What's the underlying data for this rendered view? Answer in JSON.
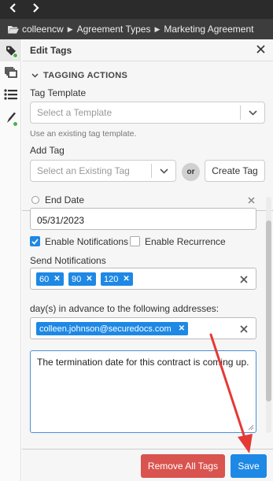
{
  "topbar": {
    "back_icon": "chevron-left-icon",
    "forward_icon": "chevron-right-icon"
  },
  "breadcrumb": {
    "folder_icon": "folder-open-icon",
    "items": [
      "colleencw",
      "Agreement Types",
      "Marketing Agreement"
    ]
  },
  "rail": {
    "items": [
      "tag-icon",
      "stack-icon",
      "list-icon",
      "pen-icon"
    ]
  },
  "panel": {
    "title": "Edit Tags"
  },
  "tagging_actions": {
    "section_title": "TAGGING ACTIONS",
    "tag_template_label": "Tag Template",
    "tag_template_placeholder": "Select a Template",
    "tag_template_help": "Use an existing tag template.",
    "add_tag_label": "Add Tag",
    "add_tag_placeholder": "Select an Existing Tag",
    "or_label": "or",
    "create_tag_label": "Create Tag"
  },
  "end_date": {
    "label": "End Date",
    "value": "05/31/2023"
  },
  "notifications": {
    "enable_notifications_label": "Enable Notifications",
    "enable_notifications_checked": true,
    "enable_recurrence_label": "Enable Recurrence",
    "enable_recurrence_checked": false,
    "send_label": "Send Notifications",
    "days": [
      "60",
      "90",
      "120"
    ],
    "addresses_label": "day(s) in advance to the following addresses:",
    "addresses": [
      "colleen.johnson@securedocs.com"
    ],
    "message": "The termination date for this contract is coming up."
  },
  "footer": {
    "remove_all_label": "Remove All Tags",
    "save_label": "Save"
  },
  "colors": {
    "accent": "#1e88e5",
    "danger": "#d9534f",
    "annotation_arrow": "#e53935",
    "status_dot": "#4caf50"
  }
}
